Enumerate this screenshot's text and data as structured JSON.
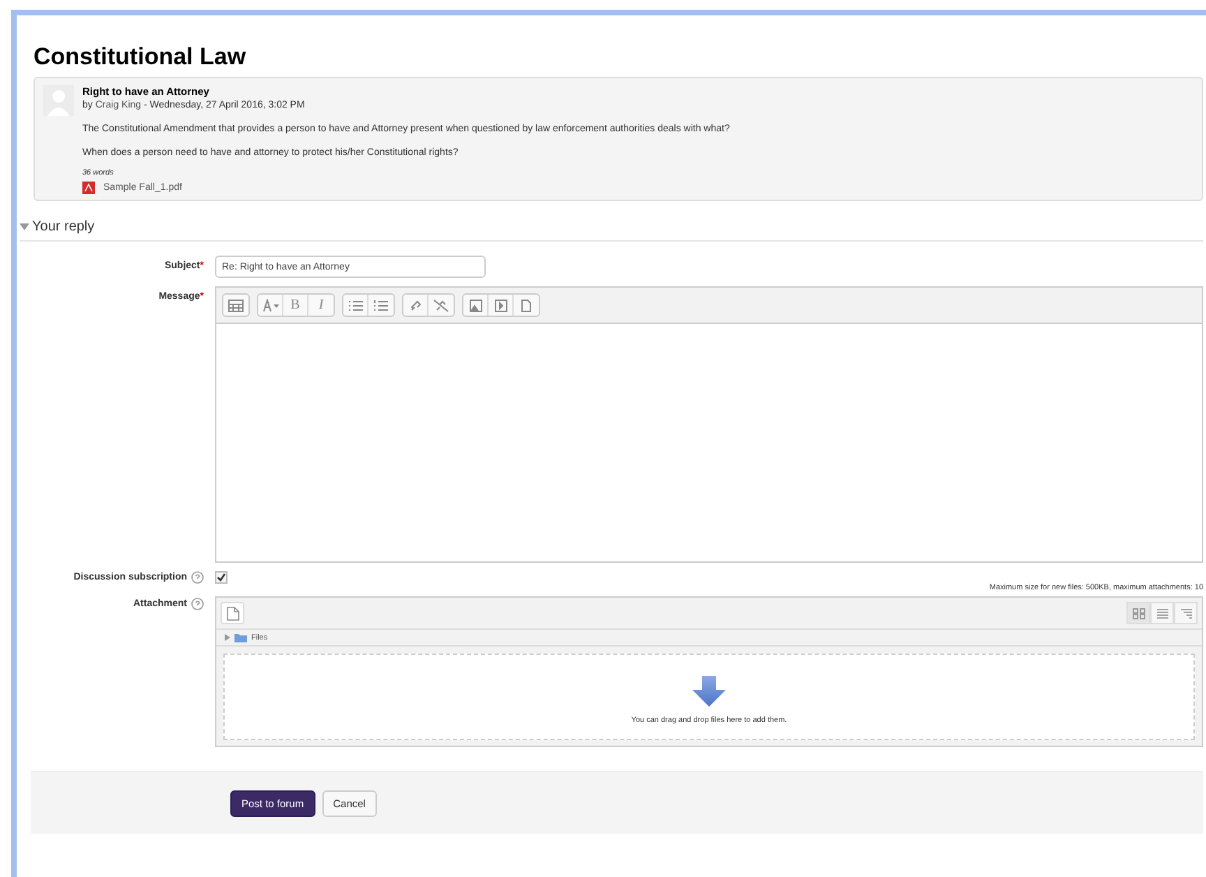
{
  "page_title": "Constitutional Law",
  "post": {
    "subject": "Right to have an Attorney",
    "by": "by",
    "author": "Craig King",
    "date": "- Wednesday, 27 April 2016, 3:02 PM",
    "paragraphs": [
      "The Constitutional Amendment that provides a person to have and Attorney present when questioned by law enforcement authorities deals with what?",
      "When does a person need to have and attorney to protect his/her Constitutional rights?"
    ],
    "word_count": "36 words",
    "attachment": "Sample Fall_1.pdf"
  },
  "section": {
    "title": "Your reply",
    "expanded": true
  },
  "form": {
    "subject_label": "Subject",
    "subject_value": "Re: Right to have an Attorney",
    "message_label": "Message",
    "required_mark": "*",
    "toolbar_groups": [
      [
        {
          "kind": "icon"
        }
      ],
      [
        {
          "kind": "icon"
        },
        {
          "kind": "bold",
          "label": "B"
        },
        {
          "kind": "italic",
          "label": "I"
        }
      ],
      [
        {
          "kind": "icon"
        },
        {
          "kind": "icon"
        }
      ],
      [
        {
          "kind": "icon"
        },
        {
          "kind": "icon"
        }
      ],
      [
        {
          "kind": "icon"
        },
        {
          "kind": "icon"
        },
        {
          "kind": "icon"
        }
      ]
    ],
    "subscription_label": "Discussion subscription",
    "subscription_checked": true,
    "attachment_label": "Attachment",
    "attachment_limits": "Maximum size for new files: 500KB, maximum attachments: 10",
    "folder_label": "Files",
    "drop_hint": "You can drag and drop files here to add them."
  },
  "buttons": [
    {
      "label": "Post to forum",
      "kind": "primary"
    },
    {
      "label": "Cancel",
      "kind": "default"
    }
  ]
}
